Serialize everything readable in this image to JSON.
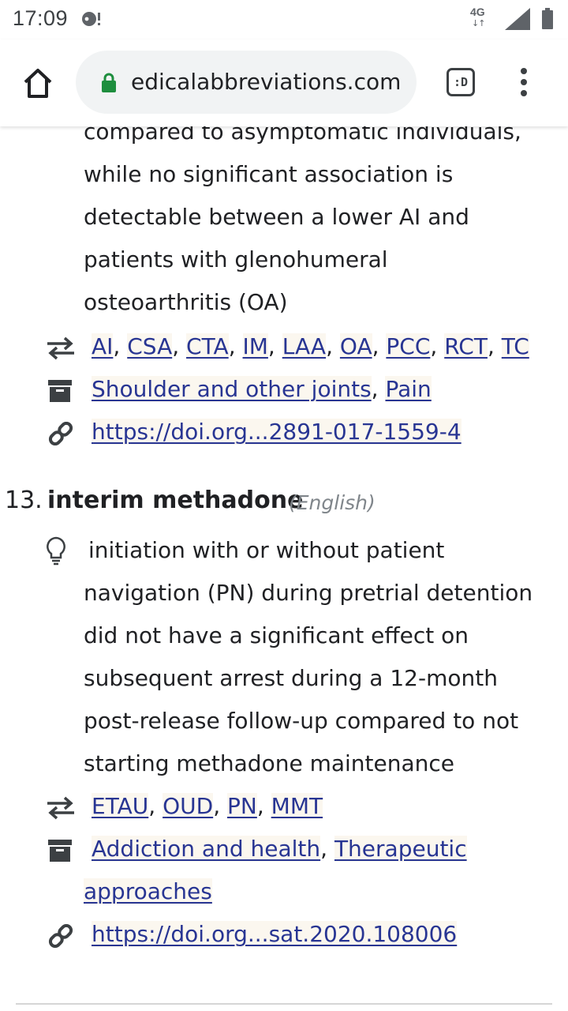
{
  "status_bar": {
    "time": "17:09",
    "network": "4G",
    "network_arrows": "↓↑"
  },
  "browser": {
    "url": "edicalabbreviations.com",
    "tabs_label": ":D"
  },
  "entry12": {
    "paragraph_lines": [
      "compared to asymptomatic individuals,",
      "while no significant association is",
      "detectable between a lower AI and",
      "patients with glenohumeral",
      "osteoarthritis (OA)"
    ],
    "abbreviations": [
      "AI",
      "CSA",
      "CTA",
      "IM",
      "LAA",
      "OA",
      "PCC",
      "RCT",
      "TC"
    ],
    "categories": [
      "Shoulder and other joints",
      "Pain"
    ],
    "doi": "https://doi.org...2891-017-1559-4"
  },
  "entry13": {
    "number": "13.",
    "term": "interim methadone",
    "language": "(English)",
    "definition_lines": [
      " initiation with or without patient",
      "navigation (PN) during pretrial detention",
      "did not have a significant effect on",
      "subsequent arrest during a 12-month",
      "post-release follow-up compared to not",
      "starting methadone maintenance"
    ],
    "abbreviations": [
      "ETAU",
      "OUD",
      "PN",
      "MMT"
    ],
    "categories_line1": "Addiction and health",
    "categories_line1b": "Therapeutic",
    "categories_line2": "approaches",
    "doi": "https://doi.org...sat.2020.108006"
  },
  "colors": {
    "link": "#283593",
    "link_bg": "#fbf7ef",
    "lock": "#1e8e3e",
    "lang": "#80868b"
  }
}
